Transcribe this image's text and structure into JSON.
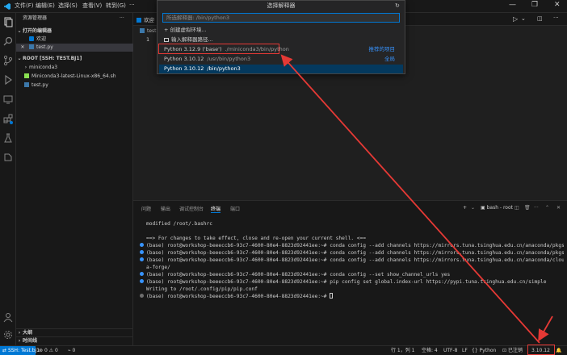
{
  "menubar": [
    "文件(F)",
    "编辑(E)",
    "选择(S)",
    "查看(V)",
    "转到(G)"
  ],
  "window_controls": [
    "—",
    "❐",
    "✕"
  ],
  "sidebar": {
    "title": "资源管理器",
    "open_editors_header": "打开的编辑器",
    "open_editors": [
      "欢迎",
      "test.py"
    ],
    "root_header": "ROOT [SSH: TEST.BJ1]",
    "files": [
      "miniconda3",
      "Miniconda3-latest-Linux-x86_64.sh",
      "test.py"
    ],
    "outline": "大纲",
    "timeline": "时间线"
  },
  "editor": {
    "tabs": [
      "欢迎",
      "test"
    ],
    "breadcrumb": "test",
    "line_number": "1"
  },
  "quickpick": {
    "title": "选择解释器",
    "placeholder": "所选解释器: /bin/python3",
    "actions": [
      "+ 创建虚拟环境...",
      "输入解释器路径..."
    ],
    "items": [
      {
        "name": "Python 3.12.9 ('base')",
        "path": "./miniconda3/bin/python",
        "tag": "推荐的项目"
      },
      {
        "name": "Python 3.10.12",
        "path": "/usr/bin/python3",
        "tag": "全局"
      },
      {
        "name": "Python 3.10.12",
        "path": "/bin/python3",
        "tag": ""
      }
    ]
  },
  "panel": {
    "tabs": [
      "问题",
      "输出",
      "调试控制台",
      "终端",
      "端口"
    ],
    "active_tab": "终端",
    "terminal_name": "bash - root",
    "lines": [
      {
        "dot": "",
        "text": "modified      /root/.bashrc"
      },
      {
        "dot": "",
        "text": ""
      },
      {
        "dot": "",
        "text": "==> For changes to take effect, close and re-open your current shell. <=="
      },
      {
        "dot": "blue",
        "text": "(base) root@workshop-beeeccb6-93c7-4600-80e4-8823d92441ee:~# conda config --add channels https://mirrors.tuna.tsinghua.edu.cn/anaconda/pkgs/free/"
      },
      {
        "dot": "blue",
        "text": "(base) root@workshop-beeeccb6-93c7-4600-80e4-8823d92441ee:~# conda config --add channels https://mirrors.tuna.tsinghua.edu.cn/anaconda/pkgs/main/"
      },
      {
        "dot": "blue",
        "text": "(base) root@workshop-beeeccb6-93c7-4600-80e4-8823d92441ee:~# conda config --add channels https://mirrors.tuna.tsinghua.edu.cn/anaconda/cloud/cond"
      },
      {
        "dot": "",
        "text": "a-forge/"
      },
      {
        "dot": "blue",
        "text": "(base) root@workshop-beeeccb6-93c7-4600-80e4-8823d92441ee:~# conda config --set show_channel_urls yes"
      },
      {
        "dot": "blue",
        "text": "(base) root@workshop-beeeccb6-93c7-4600-80e4-8823d92441ee:~# pip config set global.index-url https://pypi.tuna.tsinghua.edu.cn/simple"
      },
      {
        "dot": "",
        "text": "Writing to /root/.config/pip/pip.conf"
      },
      {
        "dot": "gray",
        "text": "(base) root@workshop-beeeccb6-93c7-4600-80e4-8823d92441ee:~# "
      }
    ]
  },
  "statusbar": {
    "remote": "SSH: Test.bj1",
    "errors": "0",
    "warnings": "0",
    "ports": "0",
    "position": "行 1，列 1",
    "spaces": "空格: 4",
    "encoding": "UTF-8",
    "eol": "LF",
    "language": "Python",
    "login": "已注销",
    "interpreter": "3.10.12"
  },
  "colors": {
    "accent": "#0078d4",
    "highlight": "#04395e",
    "annotation": "#e53935"
  }
}
